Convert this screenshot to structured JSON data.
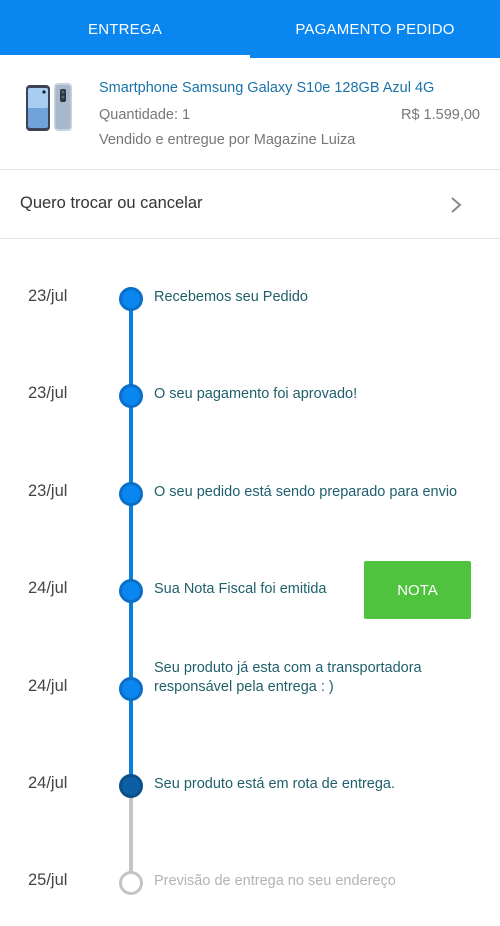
{
  "tabs": [
    {
      "label": "ENTREGA",
      "active": true
    },
    {
      "label": "PAGAMENTO PEDIDO",
      "active": false
    }
  ],
  "product": {
    "title": "Smartphone Samsung Galaxy S10e 128GB Azul 4G",
    "quantity": "Quantidade: 1",
    "price": "R$ 1.599,00",
    "seller": "Vendido e entregue por Magazine Luiza",
    "image_icon": "smartphone-product-image"
  },
  "exchange": {
    "label": "Quero trocar ou cancelar",
    "icon": "chevron-right-icon"
  },
  "timeline": {
    "steps": [
      {
        "date": "23/jul",
        "text": "Recebemos seu Pedido",
        "status": "done"
      },
      {
        "date": "23/jul",
        "text": "O seu pagamento foi aprovado!",
        "status": "done"
      },
      {
        "date": "23/jul",
        "text": "O seu pedido está sendo preparado para envio",
        "status": "done"
      },
      {
        "date": "24/jul",
        "text": "Sua Nota Fiscal foi emitida",
        "status": "done"
      },
      {
        "date": "24/jul",
        "text_line1": "Seu produto já esta com a transportadora",
        "text_line2": "responsável pela entrega : )",
        "status": "done"
      },
      {
        "date": "24/jul",
        "text": "Seu produto está em rota de entrega.",
        "status": "current"
      },
      {
        "date": "25/jul",
        "text": "Previsão de entrega no seu endereço",
        "status": "pending"
      }
    ],
    "nota_button": "NOTA"
  },
  "colors": {
    "primary": "#0a86f0",
    "timeline_active": "#0a7fd8",
    "timeline_pending": "#c4c4c4",
    "nota_button": "#4fc33e",
    "product_title": "#1a73a8",
    "step_text": "#1f5f6b"
  }
}
